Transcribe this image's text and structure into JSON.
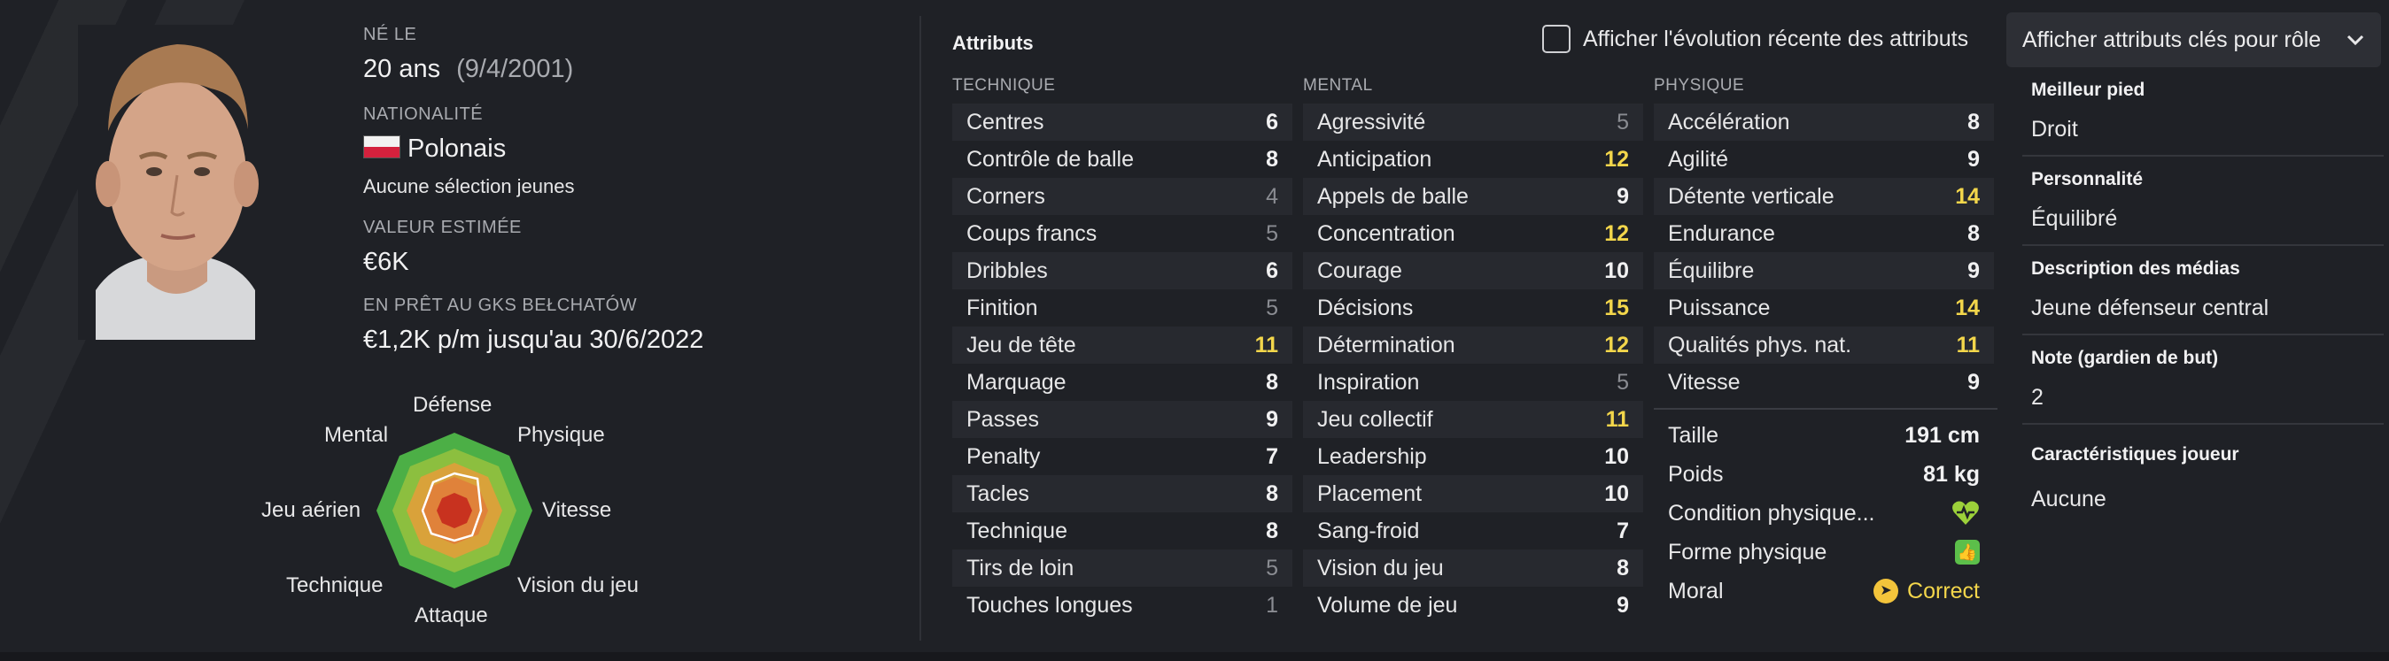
{
  "player": {
    "born_label": "NÉ LE",
    "age": "20 ans",
    "birthdate": "(9/4/2001)",
    "nationality_label": "NATIONALITÉ",
    "nationality": "Polonais",
    "youth_caps": "Aucune sélection jeunes",
    "value_label": "VALEUR ESTIMÉE",
    "value": "€6K",
    "loan_label": "EN PRÊT AU GKS BEŁCHATÓW",
    "loan_value": "€1,2K p/m jusqu'au 30/6/2022"
  },
  "radar": {
    "labels": {
      "defense": "Défense",
      "physique": "Physique",
      "vitesse": "Vitesse",
      "vision": "Vision du jeu",
      "attaque": "Attaque",
      "technique": "Technique",
      "aerien": "Jeu aérien",
      "mental": "Mental"
    }
  },
  "attributes": {
    "title": "Attributs",
    "show_recent_label": "Afficher l'évolution récente des attributs",
    "dropdown_label": "Afficher attributs clés pour rôle",
    "technique_header": "TECHNIQUE",
    "mental_header": "MENTAL",
    "physique_header": "PHYSIQUE",
    "technique": [
      {
        "name": "Centres",
        "value": "6",
        "level": "mid"
      },
      {
        "name": "Contrôle de balle",
        "value": "8",
        "level": "mid"
      },
      {
        "name": "Corners",
        "value": "4",
        "level": "low"
      },
      {
        "name": "Coups francs",
        "value": "5",
        "level": "low"
      },
      {
        "name": "Dribbles",
        "value": "6",
        "level": "mid"
      },
      {
        "name": "Finition",
        "value": "5",
        "level": "low"
      },
      {
        "name": "Jeu de tête",
        "value": "11",
        "level": "hi"
      },
      {
        "name": "Marquage",
        "value": "8",
        "level": "mid"
      },
      {
        "name": "Passes",
        "value": "9",
        "level": "mid"
      },
      {
        "name": "Penalty",
        "value": "7",
        "level": "mid"
      },
      {
        "name": "Tacles",
        "value": "8",
        "level": "mid"
      },
      {
        "name": "Technique",
        "value": "8",
        "level": "mid"
      },
      {
        "name": "Tirs de loin",
        "value": "5",
        "level": "low"
      },
      {
        "name": "Touches longues",
        "value": "1",
        "level": "low"
      }
    ],
    "mental": [
      {
        "name": "Agressivité",
        "value": "5",
        "level": "low"
      },
      {
        "name": "Anticipation",
        "value": "12",
        "level": "hi"
      },
      {
        "name": "Appels de balle",
        "value": "9",
        "level": "mid"
      },
      {
        "name": "Concentration",
        "value": "12",
        "level": "hi"
      },
      {
        "name": "Courage",
        "value": "10",
        "level": "mid"
      },
      {
        "name": "Décisions",
        "value": "15",
        "level": "hi"
      },
      {
        "name": "Détermination",
        "value": "12",
        "level": "hi"
      },
      {
        "name": "Inspiration",
        "value": "5",
        "level": "low"
      },
      {
        "name": "Jeu collectif",
        "value": "11",
        "level": "hi"
      },
      {
        "name": "Leadership",
        "value": "10",
        "level": "mid"
      },
      {
        "name": "Placement",
        "value": "10",
        "level": "mid"
      },
      {
        "name": "Sang-froid",
        "value": "7",
        "level": "mid"
      },
      {
        "name": "Vision du jeu",
        "value": "8",
        "level": "mid"
      },
      {
        "name": "Volume de jeu",
        "value": "9",
        "level": "mid"
      }
    ],
    "physique": [
      {
        "name": "Accélération",
        "value": "8",
        "level": "mid"
      },
      {
        "name": "Agilité",
        "value": "9",
        "level": "mid"
      },
      {
        "name": "Détente verticale",
        "value": "14",
        "level": "hi"
      },
      {
        "name": "Endurance",
        "value": "8",
        "level": "mid"
      },
      {
        "name": "Équilibre",
        "value": "9",
        "level": "mid"
      },
      {
        "name": "Puissance",
        "value": "14",
        "level": "hi"
      },
      {
        "name": "Qualités phys. nat.",
        "value": "11",
        "level": "hi"
      },
      {
        "name": "Vitesse",
        "value": "9",
        "level": "mid"
      }
    ],
    "extra": {
      "height_label": "Taille",
      "height": "191 cm",
      "weight_label": "Poids",
      "weight": "81 kg",
      "condition_label": "Condition physique...",
      "form_label": "Forme physique",
      "morale_label": "Moral",
      "morale": "Correct"
    }
  },
  "side": {
    "foot_label": "Meilleur pied",
    "foot": "Droit",
    "personality_label": "Personnalité",
    "personality": "Équilibré",
    "media_label": "Description des médias",
    "media": "Jeune défenseur central",
    "gk_label": "Note (gardien de but)",
    "gk": "2",
    "traits_label": "Caractéristiques joueur",
    "traits": "Aucune"
  },
  "colors": {
    "background": "#1f2126",
    "highlight": "#f3d64b",
    "low": "#8a8c92",
    "radar_outer": "#4caf46",
    "radar_mid": "#d9a23a",
    "radar_inner": "#c8321f"
  }
}
